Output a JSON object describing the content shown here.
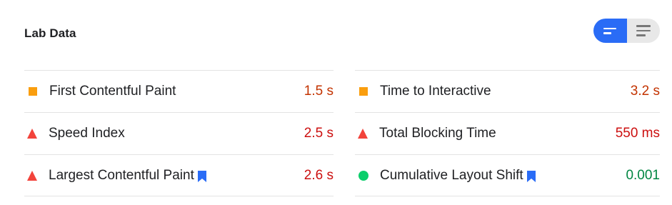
{
  "header": {
    "title": "Lab Data",
    "view_toggle": [
      {
        "icon": "opportunity-view-icon",
        "active": true
      },
      {
        "icon": "list-view-icon",
        "active": false
      }
    ]
  },
  "colors": {
    "accent": "#2a6cf6",
    "average": "#fa9e0e",
    "average_text": "#c33300",
    "fail": "#f2433b",
    "fail_text": "#cc0f0f",
    "pass": "#0cce6b",
    "pass_text": "#018642"
  },
  "metrics_left": [
    {
      "label": "First Contentful Paint",
      "value": "1.5 s",
      "status": "average",
      "icon": "square-icon",
      "core_web_vital": false
    },
    {
      "label": "Speed Index",
      "value": "2.5 s",
      "status": "fail",
      "icon": "triangle-icon",
      "core_web_vital": false
    },
    {
      "label": "Largest Contentful Paint",
      "value": "2.6 s",
      "status": "fail",
      "icon": "triangle-icon",
      "core_web_vital": true
    }
  ],
  "metrics_right": [
    {
      "label": "Time to Interactive",
      "value": "3.2 s",
      "status": "average",
      "icon": "square-icon",
      "core_web_vital": false
    },
    {
      "label": "Total Blocking Time",
      "value": "550 ms",
      "status": "fail",
      "icon": "triangle-icon",
      "core_web_vital": false
    },
    {
      "label": "Cumulative Layout Shift",
      "value": "0.001",
      "status": "pass",
      "icon": "circle-icon",
      "core_web_vital": true
    }
  ]
}
